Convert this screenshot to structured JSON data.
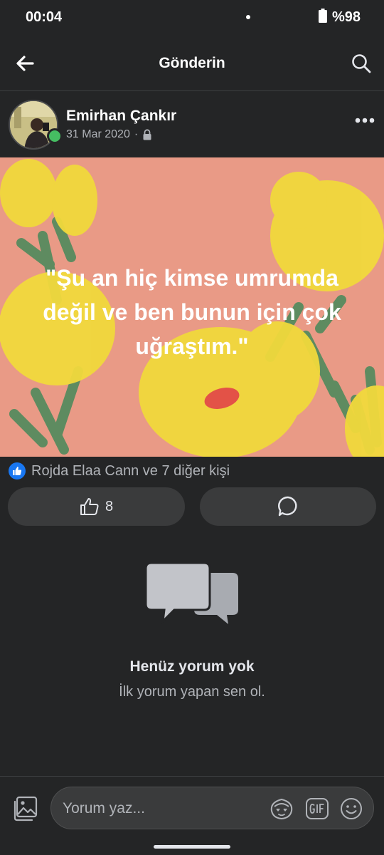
{
  "status_bar": {
    "time": "00:04",
    "battery": "%98"
  },
  "header": {
    "title": "Gönderin"
  },
  "post": {
    "author_name": "Emirhan Çankır",
    "date": "31 Mar 2020",
    "separator": "·",
    "quote": "\"Şu an hiç kimse umrumda değil ve ben bunun için çok uğraştım.\"",
    "reactions_summary": "Rojda Elaa Cann ve 7 diğer kişi",
    "like_count": "8"
  },
  "empty_state": {
    "title": "Henüz yorum yok",
    "subtitle": "İlk yorum yapan sen ol."
  },
  "composer": {
    "placeholder": "Yorum yaz..."
  },
  "colors": {
    "background": "#242526",
    "online": "#45bd62",
    "like_blue": "#1877f2",
    "image_bg": "#e99a86",
    "flower_yellow": "#f1d93c"
  }
}
